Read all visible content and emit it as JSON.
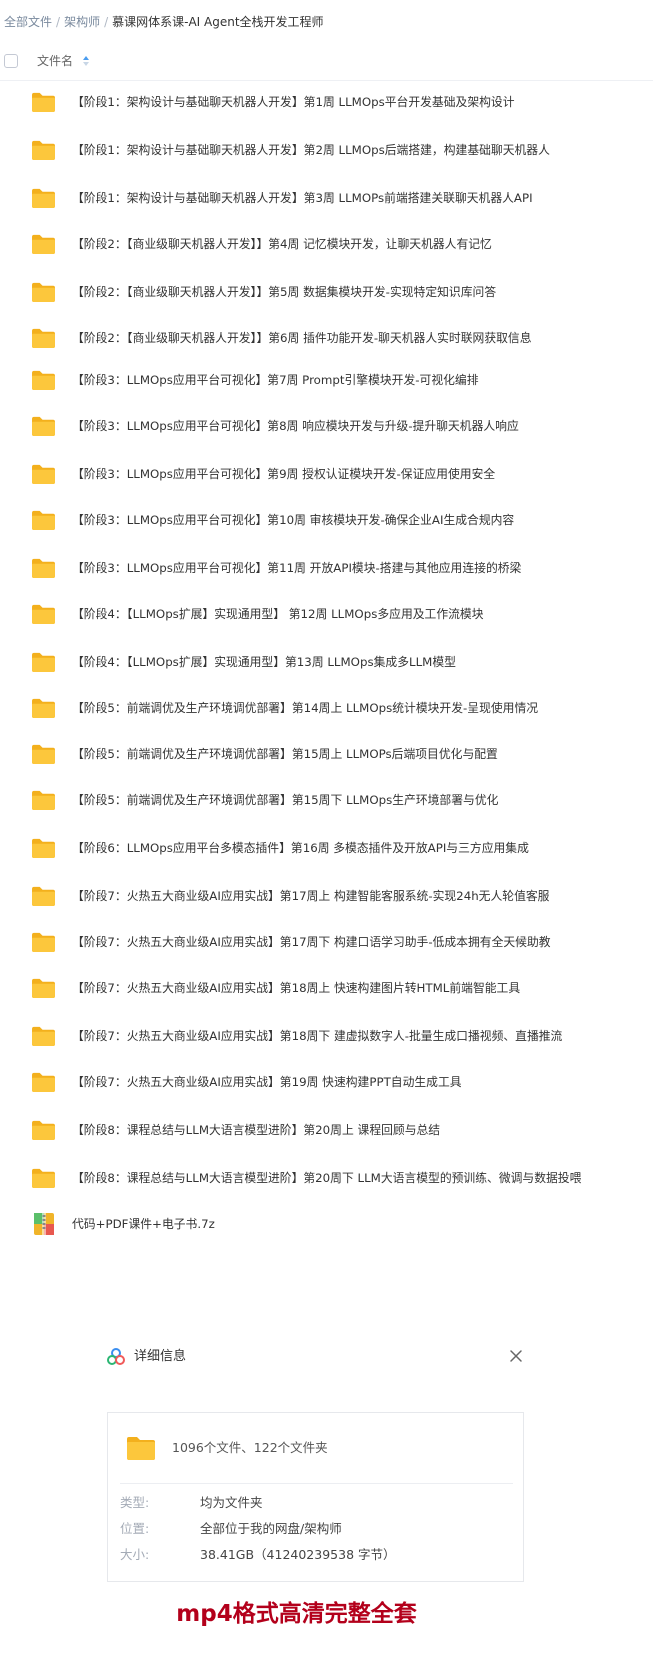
{
  "breadcrumb": {
    "items": [
      "全部文件",
      "架构师"
    ],
    "current": "慕课网体系课-AI Agent全栈开发工程师"
  },
  "header": {
    "column_name": "文件名"
  },
  "files": [
    {
      "name": "【阶段1：架构设计与基础聊天机器人开发】第1周 LLMOps平台开发基础及架构设计",
      "type": "folder"
    },
    {
      "name": "【阶段1：架构设计与基础聊天机器人开发】第2周 LLMOps后端搭建，构建基础聊天机器人",
      "type": "folder"
    },
    {
      "name": "【阶段1：架构设计与基础聊天机器人开发】第3周 LLMOPs前端搭建关联聊天机器人API",
      "type": "folder"
    },
    {
      "name": "【阶段2：【商业级聊天机器人开发】】第4周 记忆模块开发，让聊天机器人有记忆",
      "type": "folder"
    },
    {
      "name": "【阶段2：【商业级聊天机器人开发】】第5周 数据集模块开发-实现特定知识库问答",
      "type": "folder"
    },
    {
      "name": "【阶段2：【商业级聊天机器人开发】】第6周 插件功能开发-聊天机器人实时联网获取信息",
      "type": "folder"
    },
    {
      "name": "【阶段3：LLMOps应用平台可视化】第7周 Prompt引擎模块开发-可视化编排",
      "type": "folder"
    },
    {
      "name": "【阶段3：LLMOps应用平台可视化】第8周 响应模块开发与升级-提升聊天机器人响应",
      "type": "folder"
    },
    {
      "name": "【阶段3：LLMOps应用平台可视化】第9周 授权认证模块开发-保证应用使用安全",
      "type": "folder"
    },
    {
      "name": "【阶段3：LLMOps应用平台可视化】第10周 审核模块开发-确保企业AI生成合规内容",
      "type": "folder"
    },
    {
      "name": "【阶段3：LLMOps应用平台可视化】第11周 开放API模块-搭建与其他应用连接的桥梁",
      "type": "folder"
    },
    {
      "name": "【阶段4：【LLMOps扩展】实现通用型】 第12周 LLMOps多应用及工作流模块",
      "type": "folder"
    },
    {
      "name": "【阶段4：【LLMOps扩展】实现通用型】第13周 LLMOps集成多LLM模型",
      "type": "folder"
    },
    {
      "name": "【阶段5：前端调优及生产环境调优部署】第14周上 LLMOps统计模块开发-呈现使用情况",
      "type": "folder"
    },
    {
      "name": "【阶段5：前端调优及生产环境调优部署】第15周上 LLMOPs后端项目优化与配置",
      "type": "folder"
    },
    {
      "name": "【阶段5：前端调优及生产环境调优部署】第15周下 LLMOps生产环境部署与优化",
      "type": "folder"
    },
    {
      "name": "【阶段6：LLMOps应用平台多模态插件】第16周 多模态插件及开放API与三方应用集成",
      "type": "folder"
    },
    {
      "name": "【阶段7：火热五大商业级AI应用实战】第17周上 构建智能客服系统-实现24h无人轮值客服",
      "type": "folder"
    },
    {
      "name": "【阶段7：火热五大商业级AI应用实战】第17周下 构建口语学习助手-低成本拥有全天候助教",
      "type": "folder"
    },
    {
      "name": "【阶段7：火热五大商业级AI应用实战】第18周上 快速构建图片转HTML前端智能工具",
      "type": "folder"
    },
    {
      "name": "【阶段7：火热五大商业级AI应用实战】第18周下 建虚拟数字人-批量生成口播视频、直播推流",
      "type": "folder"
    },
    {
      "name": "【阶段7：火热五大商业级AI应用实战】第19周 快速构建PPT自动生成工具",
      "type": "folder"
    },
    {
      "name": "【阶段8：课程总结与LLM大语言模型进阶】第20周上 课程回顾与总结",
      "type": "folder"
    },
    {
      "name": "【阶段8：课程总结与LLM大语言模型进阶】第20周下 LLM大语言模型的预训练、微调与数据投喂",
      "type": "folder"
    },
    {
      "name": "代码+PDF课件+电子书.7z",
      "type": "archive"
    }
  ],
  "details": {
    "title": "详细信息",
    "summary": "1096个文件、122个文件夹",
    "type_label": "类型:",
    "type_value": "均为文件夹",
    "location_label": "位置:",
    "location_value": "全部位于我的网盘/架构师",
    "size_label": "大小:",
    "size_value": "38.41GB（41240239538 字节）"
  },
  "promo": {
    "text": "mp4格式高清完整全套"
  },
  "colors": {
    "folder": "#fcc73c",
    "folder_dark": "#f3b01d",
    "promo": "#b3001b",
    "breadcrumb_link": "#7a8a9e"
  }
}
